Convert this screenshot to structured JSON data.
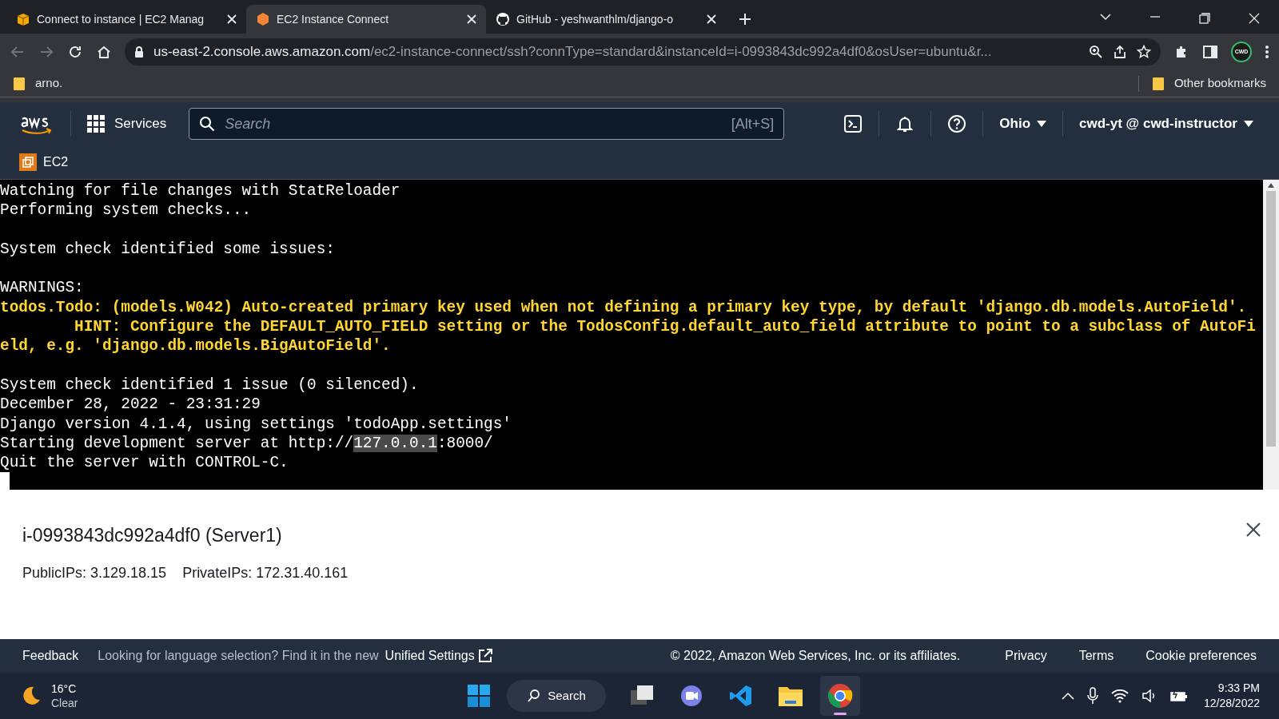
{
  "browser": {
    "tabs": [
      {
        "title": "Connect to instance | EC2 Manag",
        "selected": false
      },
      {
        "title": "EC2 Instance Connect",
        "selected": true
      },
      {
        "title": "GitHub - yeshwanthlm/django-o",
        "selected": false
      }
    ],
    "address": {
      "host": "us-east-2.console.aws.amazon.com",
      "path": "/ec2-instance-connect/ssh?connType=standard&instanceId=i-0993843dc992a4df0&osUser=ubuntu&r..."
    },
    "profile_badge": "CWD",
    "bookmarks": [
      "arno."
    ],
    "other_bookmarks": "Other bookmarks"
  },
  "aws_nav": {
    "services": "Services",
    "search_placeholder": "Search",
    "search_shortcut": "[Alt+S]",
    "region": "Ohio",
    "account": "cwd-yt @ cwd-instructor",
    "service": "EC2"
  },
  "terminal": {
    "lines": [
      {
        "kind": "normal",
        "segments": [
          {
            "text": "Watching for file changes with StatReloader",
            "selected": false
          }
        ]
      },
      {
        "kind": "normal",
        "segments": [
          {
            "text": "Performing system checks...",
            "selected": false
          }
        ]
      },
      {
        "kind": "blank"
      },
      {
        "kind": "normal",
        "segments": [
          {
            "text": "System check identified some issues:",
            "selected": false
          }
        ]
      },
      {
        "kind": "blank"
      },
      {
        "kind": "normal",
        "segments": [
          {
            "text": "WARNINGS:",
            "selected": false
          }
        ]
      },
      {
        "kind": "warning",
        "segments": [
          {
            "text": "todos.Todo: (models.W042) Auto-created primary key used when not defining a primary key type, by default 'django.db.models.AutoField'.",
            "selected": false
          }
        ]
      },
      {
        "kind": "warning",
        "segments": [
          {
            "text": "        HINT: Configure the DEFAULT_AUTO_FIELD setting or the TodosConfig.default_auto_field attribute to point to a subclass of AutoFi",
            "selected": false
          }
        ]
      },
      {
        "kind": "warning",
        "segments": [
          {
            "text": "eld, e.g. 'django.db.models.BigAutoField'.",
            "selected": false
          }
        ]
      },
      {
        "kind": "blank"
      },
      {
        "kind": "normal",
        "segments": [
          {
            "text": "System check identified 1 issue (0 silenced).",
            "selected": false
          }
        ]
      },
      {
        "kind": "normal",
        "segments": [
          {
            "text": "December 28, 2022 - 23:31:29",
            "selected": false
          }
        ]
      },
      {
        "kind": "normal",
        "segments": [
          {
            "text": "Django version 4.1.4, using settings 'todoApp.settings'",
            "selected": false
          }
        ]
      },
      {
        "kind": "normal",
        "segments": [
          {
            "text": "Starting development server at http://",
            "selected": false
          },
          {
            "text": "127.0.0.1",
            "selected": true
          },
          {
            "text": ":8000/",
            "selected": false
          }
        ]
      },
      {
        "kind": "normal",
        "segments": [
          {
            "text": "Quit the server with CONTROL-C.",
            "selected": false
          }
        ]
      },
      {
        "kind": "cursor"
      }
    ]
  },
  "instance": {
    "title": "i-0993843dc992a4df0 (Server1)",
    "public_ips": "PublicIPs: 3.129.18.15",
    "private_ips": "PrivateIPs: 172.31.40.161"
  },
  "footer": {
    "feedback": "Feedback",
    "notice": "Looking for language selection? Find it in the new",
    "link": "Unified Settings",
    "copyright": "© 2022, Amazon Web Services, Inc. or its affiliates.",
    "links": [
      "Privacy",
      "Terms",
      "Cookie preferences"
    ]
  },
  "taskbar": {
    "temperature": "16°C",
    "condition": "Clear",
    "search": "Search",
    "apps": [
      {
        "kind": "files",
        "selected": false
      },
      {
        "kind": "meet",
        "selected": false
      },
      {
        "kind": "vscode",
        "selected": false
      },
      {
        "kind": "explorer",
        "selected": false
      },
      {
        "kind": "chrome",
        "selected": true
      }
    ],
    "time": "9:33 PM",
    "date": "12/28/2022"
  }
}
